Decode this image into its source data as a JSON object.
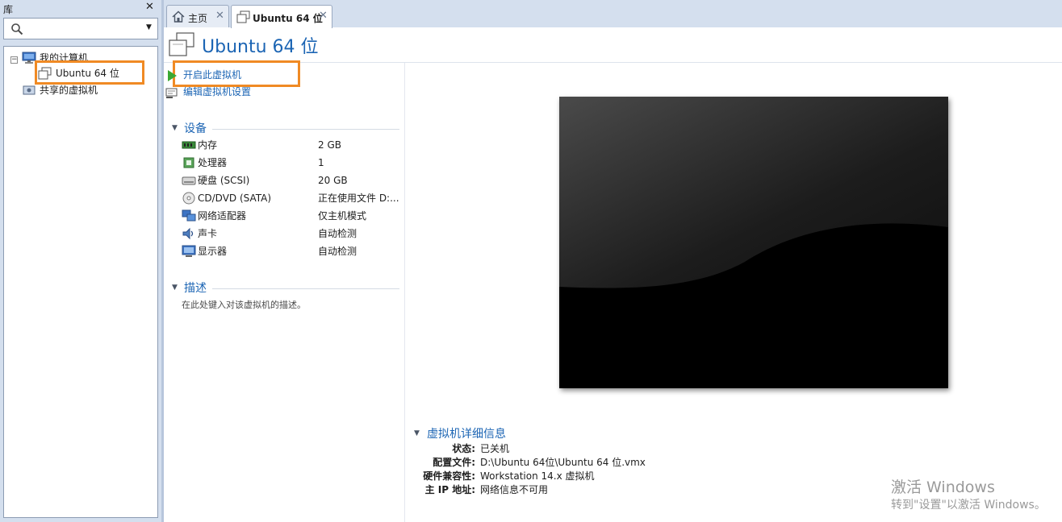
{
  "library": {
    "title": "库",
    "close": "✕",
    "search_placeholder": "",
    "tree": {
      "my_computer": "我的计算机",
      "vm_ubuntu": "Ubuntu 64 位",
      "shared_vms": "共享的虚拟机"
    }
  },
  "tabs": [
    {
      "label": "主页",
      "icon": "home-icon"
    },
    {
      "label": "Ubuntu 64 位",
      "icon": "vm-icon"
    }
  ],
  "vm": {
    "title": "Ubuntu 64 位",
    "commands": {
      "power_on": "开启此虚拟机",
      "edit_settings": "编辑虚拟机设置"
    },
    "devices_section": "设备",
    "devices": [
      {
        "name": "内存",
        "value": "2 GB",
        "icon": "memory-icon"
      },
      {
        "name": "处理器",
        "value": "1",
        "icon": "processor-icon"
      },
      {
        "name": "硬盘 (SCSI)",
        "value": "20 GB",
        "icon": "hard-disk-icon"
      },
      {
        "name": "CD/DVD (SATA)",
        "value": "正在使用文件 D:...",
        "icon": "cd-dvd-icon"
      },
      {
        "name": "网络适配器",
        "value": "仅主机模式",
        "icon": "network-adapter-icon"
      },
      {
        "name": "声卡",
        "value": "自动检测",
        "icon": "sound-card-icon"
      },
      {
        "name": "显示器",
        "value": "自动检测",
        "icon": "display-icon"
      }
    ],
    "description_section": "描述",
    "description_placeholder": "在此处键入对该虚拟机的描述。",
    "details_section": "虚拟机详细信息",
    "details": [
      {
        "key": "状态:",
        "value": "已关机"
      },
      {
        "key": "配置文件:",
        "value": "D:\\Ubuntu 64位\\Ubuntu 64 位.vmx"
      },
      {
        "key": "硬件兼容性:",
        "value": "Workstation 14.x 虚拟机"
      },
      {
        "key": "主 IP 地址:",
        "value": "网络信息不可用"
      }
    ]
  },
  "watermark": {
    "line1": "激活 Windows",
    "line2": "转到\"设置\"以激活 Windows。"
  },
  "colors": {
    "accent_blue": "#1c65b4",
    "highlight_orange": "#f08a24",
    "pane_bg": "#d4dfee",
    "play_green": "#3aa832"
  }
}
